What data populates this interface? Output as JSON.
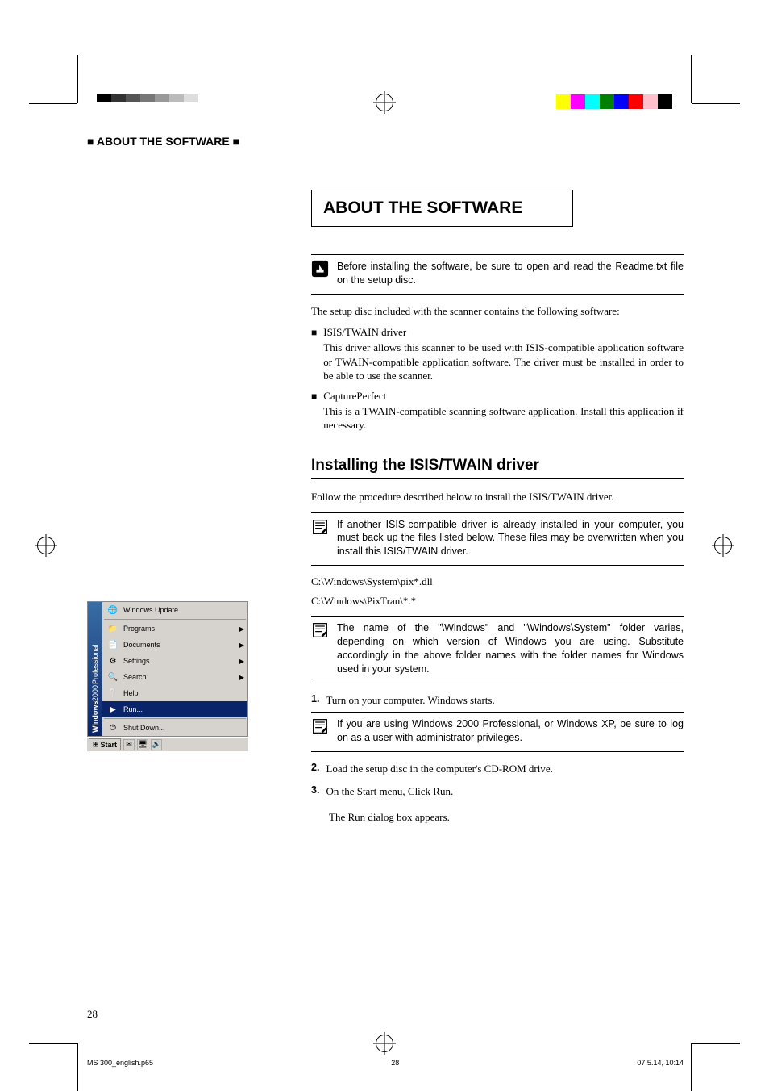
{
  "running_head": {
    "prefix": "■",
    "text": "ABOUT THE SOFTWARE",
    "suffix": "■"
  },
  "title": "ABOUT THE SOFTWARE",
  "intro_note": "Before installing the software, be sure to open and read the Readme.txt file on the setup disc.",
  "intro_body": "The setup disc included with the scanner contains the following software:",
  "bullets": [
    {
      "title": "ISIS/TWAIN driver",
      "body": "This driver allows this scanner to be used with ISIS-compatible application software or TWAIN-compatible application software. The driver must be installed in order to be able to use the scanner."
    },
    {
      "title": "CapturePerfect",
      "body": "This is a TWAIN-compatible scanning software application. Install this application if necessary."
    }
  ],
  "h2": "Installing the ISIS/TWAIN driver",
  "h2_intro": "Follow the procedure described below to install the ISIS/TWAIN driver.",
  "note1": "If another ISIS-compatible driver is already installed in your computer, you must back up the files listed below. These files may be overwritten when you install this ISIS/TWAIN driver.",
  "path1": "C:\\Windows\\System\\pix*.dll",
  "path2": "C:\\Windows\\PixTran\\*.*",
  "note2": "The name of the \"\\Windows\" and \"\\Windows\\System\" folder varies, depending on which version of Windows you are using. Substitute accordingly in the above folder names with the folder names for Windows used in your system.",
  "steps": [
    {
      "num": "1.",
      "text": "Turn on your computer. Windows starts."
    }
  ],
  "note3": "If you are using Windows 2000 Professional, or Windows XP, be sure to log on as a user with administrator privileges.",
  "steps2": [
    {
      "num": "2.",
      "text": "Load the setup disc in the computer's CD-ROM drive."
    },
    {
      "num": "3.",
      "text": "On the Start menu, Click Run."
    }
  ],
  "result_note": "The Run dialog box appears.",
  "startmenu": {
    "stripe_bold": "Windows",
    "stripe_mid": "2000",
    "stripe_light": "Professional",
    "items": [
      {
        "icon": "🌐",
        "label": "Windows Update",
        "arrow": false
      },
      {
        "divider": true
      },
      {
        "icon": "📁",
        "label": "Programs",
        "arrow": true
      },
      {
        "icon": "📄",
        "label": "Documents",
        "arrow": true
      },
      {
        "icon": "⚙",
        "label": "Settings",
        "arrow": true
      },
      {
        "icon": "🔍",
        "label": "Search",
        "arrow": true
      },
      {
        "icon": "❔",
        "label": "Help",
        "arrow": false
      },
      {
        "icon": "▶",
        "label": "Run...",
        "arrow": false,
        "selected": true
      },
      {
        "divider": true
      },
      {
        "icon": "⏻",
        "label": "Shut Down...",
        "arrow": false
      }
    ],
    "taskbar": {
      "start": "Start"
    }
  },
  "page_number": "28",
  "footer": {
    "file": "MS 300_english.p65",
    "page": "28",
    "datetime": "07.5.14, 10:14"
  },
  "colors": {
    "color_bar": [
      "#ffff00",
      "#ff00ff",
      "#00ffff",
      "#008000",
      "#0000ff",
      "#ff0000",
      "#ffc0cb",
      "#000000"
    ],
    "gray_bar": [
      "#000000",
      "#333333",
      "#555555",
      "#777777",
      "#999999",
      "#bbbbbb",
      "#dddddd",
      "#ffffff"
    ]
  }
}
